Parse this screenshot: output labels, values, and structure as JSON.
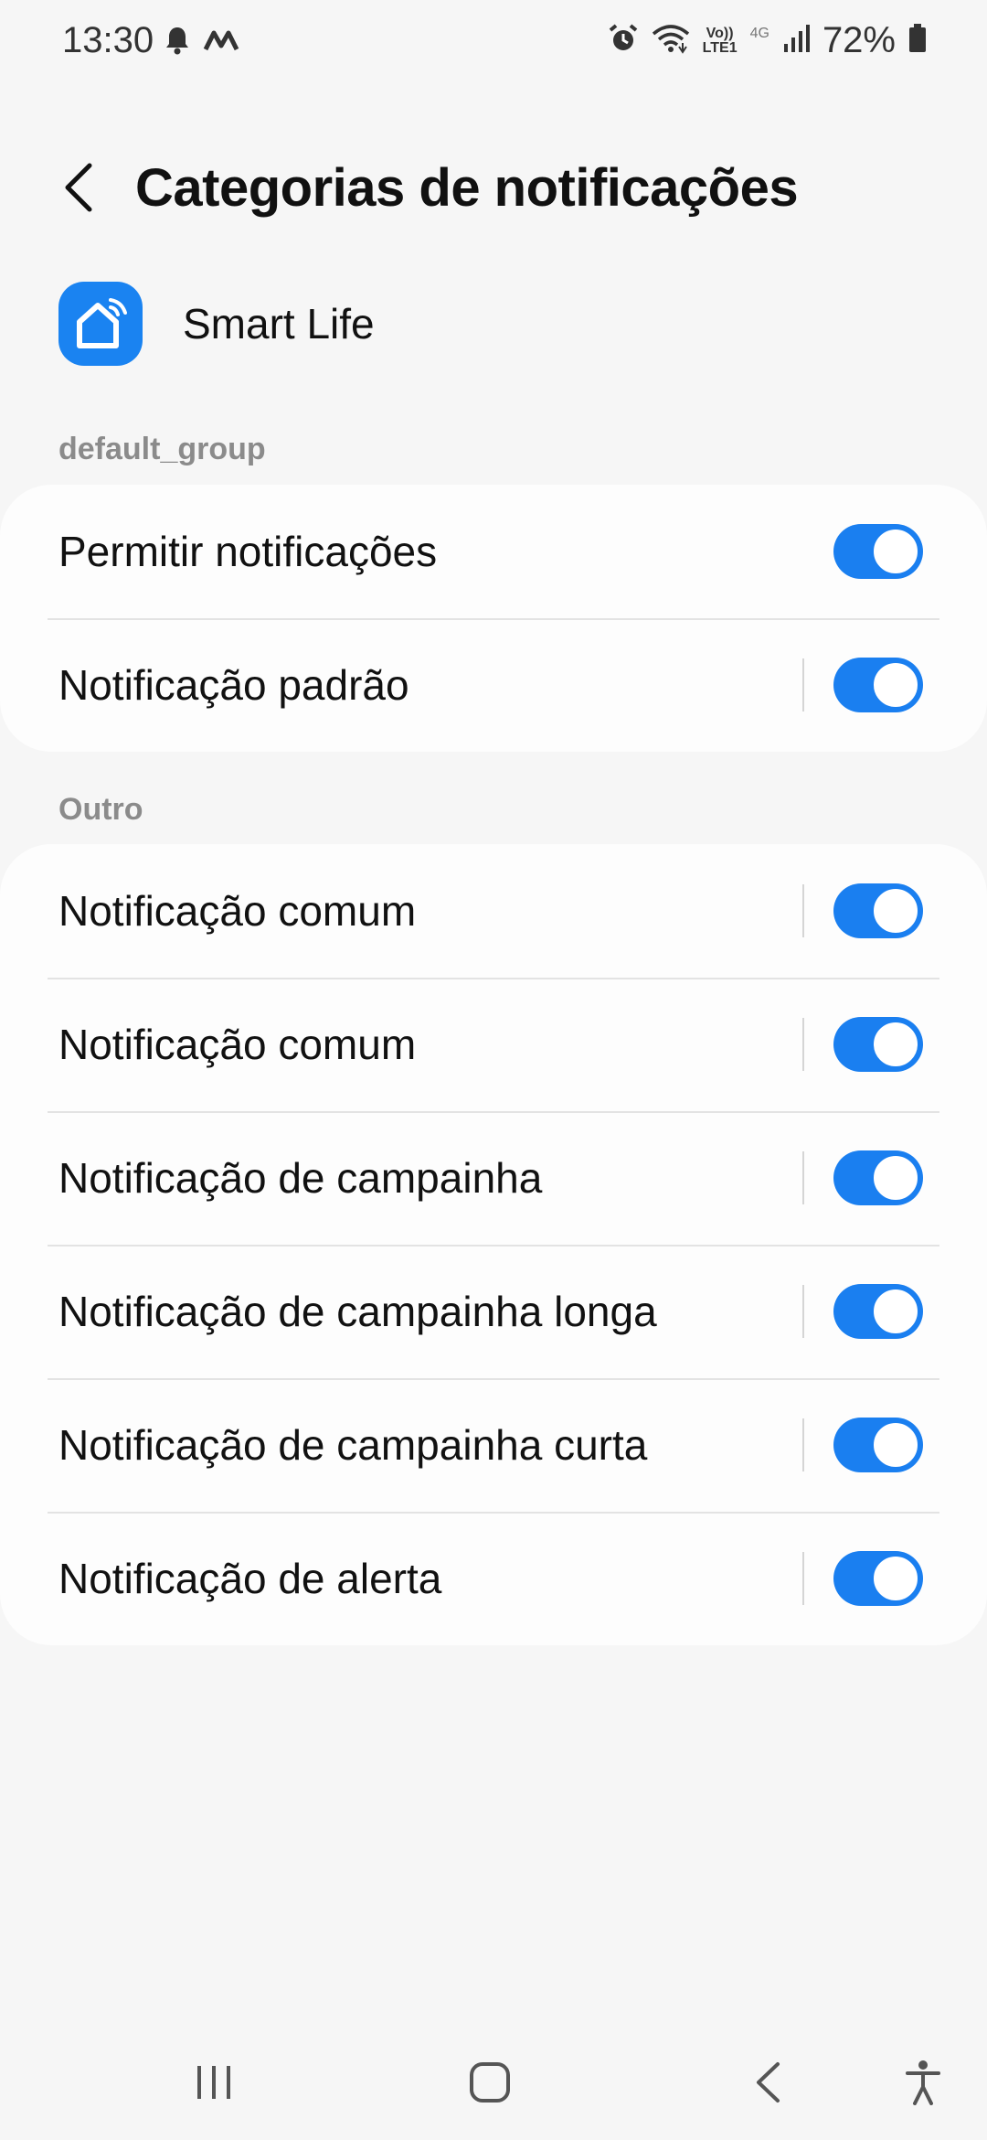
{
  "status_bar": {
    "time": "13:30",
    "left_icons": [
      "notification-bell-icon",
      "m-app-icon"
    ],
    "right_icons": [
      "alarm-icon",
      "wifi-icon",
      "volte-icon",
      "signal-icon",
      "battery-icon"
    ],
    "volte_line1": "Vo))",
    "volte_line2": "LTE1",
    "network_type": "4G",
    "battery_percent": "72%"
  },
  "header": {
    "title": "Categorias de notificações"
  },
  "app": {
    "name": "Smart Life",
    "icon": "smart-home-icon",
    "icon_color": "#1a83f1"
  },
  "sections": [
    {
      "label": "default_group",
      "rows": [
        {
          "label": "Permitir notificações",
          "enabled": true,
          "has_divider": false
        },
        {
          "label": "Notificação padrão",
          "enabled": true,
          "has_divider": true
        }
      ]
    },
    {
      "label": "Outro",
      "rows": [
        {
          "label": "Notificação comum",
          "enabled": true,
          "has_divider": true
        },
        {
          "label": "Notificação comum",
          "enabled": true,
          "has_divider": true
        },
        {
          "label": "Notificação de campainha",
          "enabled": true,
          "has_divider": true
        },
        {
          "label": "Notificação de campainha longa",
          "enabled": true,
          "has_divider": true
        },
        {
          "label": "Notificação de campainha curta",
          "enabled": true,
          "has_divider": true
        },
        {
          "label": "Notificação de alerta",
          "enabled": true,
          "has_divider": true
        }
      ]
    }
  ],
  "nav_bar": {
    "buttons": [
      "recent-apps-icon",
      "home-icon",
      "back-icon",
      "accessibility-icon"
    ]
  },
  "colors": {
    "accent": "#1a7ff0",
    "background": "#f6f6f6",
    "card": "#fdfdfd",
    "section_label": "#8b8b8b"
  }
}
